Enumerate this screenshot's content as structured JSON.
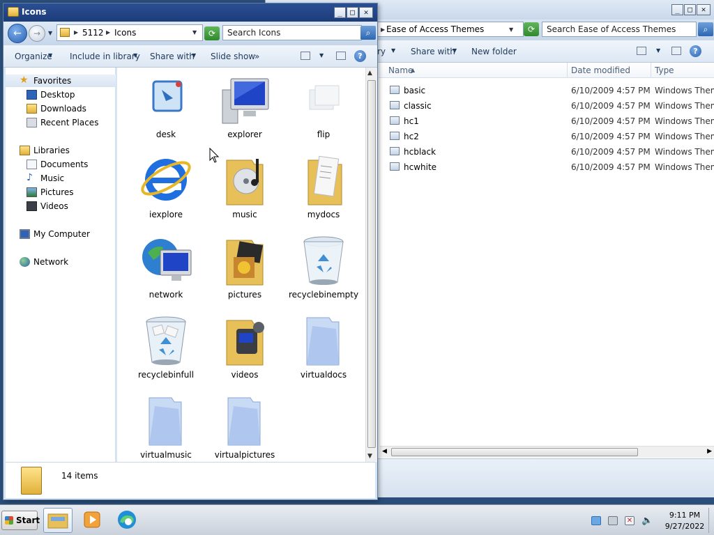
{
  "colors": {
    "front_title_bar": "#1f427f",
    "selection_fav": "#d9e5f2",
    "toolbar_text": "#1e395b",
    "back_search_green": "#2f8a2c"
  },
  "back_window": {
    "breadcrumb": "Ease of Access Themes",
    "search_placeholder": "Search Ease of Access Themes",
    "toolbar": {
      "library_partial": "ry",
      "share_with": "Share with",
      "new_folder": "New folder"
    },
    "columns": {
      "name": "Name",
      "date_modified": "Date modified",
      "type": "Type"
    },
    "files": [
      {
        "name": "basic",
        "date": "6/10/2009 4:57 PM",
        "type": "Windows Theme F"
      },
      {
        "name": "classic",
        "date": "6/10/2009 4:57 PM",
        "type": "Windows Theme F"
      },
      {
        "name": "hc1",
        "date": "6/10/2009 4:57 PM",
        "type": "Windows Theme F"
      },
      {
        "name": "hc2",
        "date": "6/10/2009 4:57 PM",
        "type": "Windows Theme F"
      },
      {
        "name": "hcblack",
        "date": "6/10/2009 4:57 PM",
        "type": "Windows Theme F"
      },
      {
        "name": "hcwhite",
        "date": "6/10/2009 4:57 PM",
        "type": "Windows Theme F"
      }
    ]
  },
  "front_window": {
    "title": "Icons",
    "breadcrumb": [
      "5112",
      "Icons"
    ],
    "search_placeholder": "Search Icons",
    "toolbar": {
      "organize": "Organize",
      "include_in_library": "Include in library",
      "share_with": "Share with",
      "slide_show": "Slide show",
      "more": "»"
    },
    "nav": {
      "favorites": {
        "label": "Favorites",
        "items": [
          "Desktop",
          "Downloads",
          "Recent Places"
        ]
      },
      "libraries": {
        "label": "Libraries",
        "items": [
          "Documents",
          "Music",
          "Pictures",
          "Videos"
        ]
      },
      "computer": "My Computer",
      "network": "Network"
    },
    "icons": [
      {
        "label": "desk",
        "icon": "desk-icon"
      },
      {
        "label": "explorer",
        "icon": "explorer-monitor-icon"
      },
      {
        "label": "flip",
        "icon": "flip-icon"
      },
      {
        "label": "iexplore",
        "icon": "internet-explorer-icon"
      },
      {
        "label": "music",
        "icon": "music-folder-icon"
      },
      {
        "label": "mydocs",
        "icon": "documents-folder-icon"
      },
      {
        "label": "network",
        "icon": "network-globe-icon"
      },
      {
        "label": "pictures",
        "icon": "pictures-folder-icon"
      },
      {
        "label": "recyclebinempty",
        "icon": "recycle-bin-empty-icon"
      },
      {
        "label": "recyclebinfull",
        "icon": "recycle-bin-full-icon"
      },
      {
        "label": "videos",
        "icon": "videos-folder-icon"
      },
      {
        "label": "virtualdocs",
        "icon": "virtual-folder-icon"
      },
      {
        "label": "virtualmusic",
        "icon": "virtual-folder-icon"
      },
      {
        "label": "virtualpictures",
        "icon": "virtual-folder-icon"
      }
    ],
    "status": {
      "count": "14 items"
    }
  },
  "taskbar": {
    "start_label": "Start",
    "apps": [
      "explorer-folders-icon",
      "media-player-icon",
      "edge-browser-icon"
    ],
    "tray_icons": [
      "action-center-icon",
      "network-status-icon",
      "security-alert-icon",
      "volume-icon"
    ],
    "clock": {
      "time": "9:11 PM",
      "date": "9/27/2022"
    }
  }
}
